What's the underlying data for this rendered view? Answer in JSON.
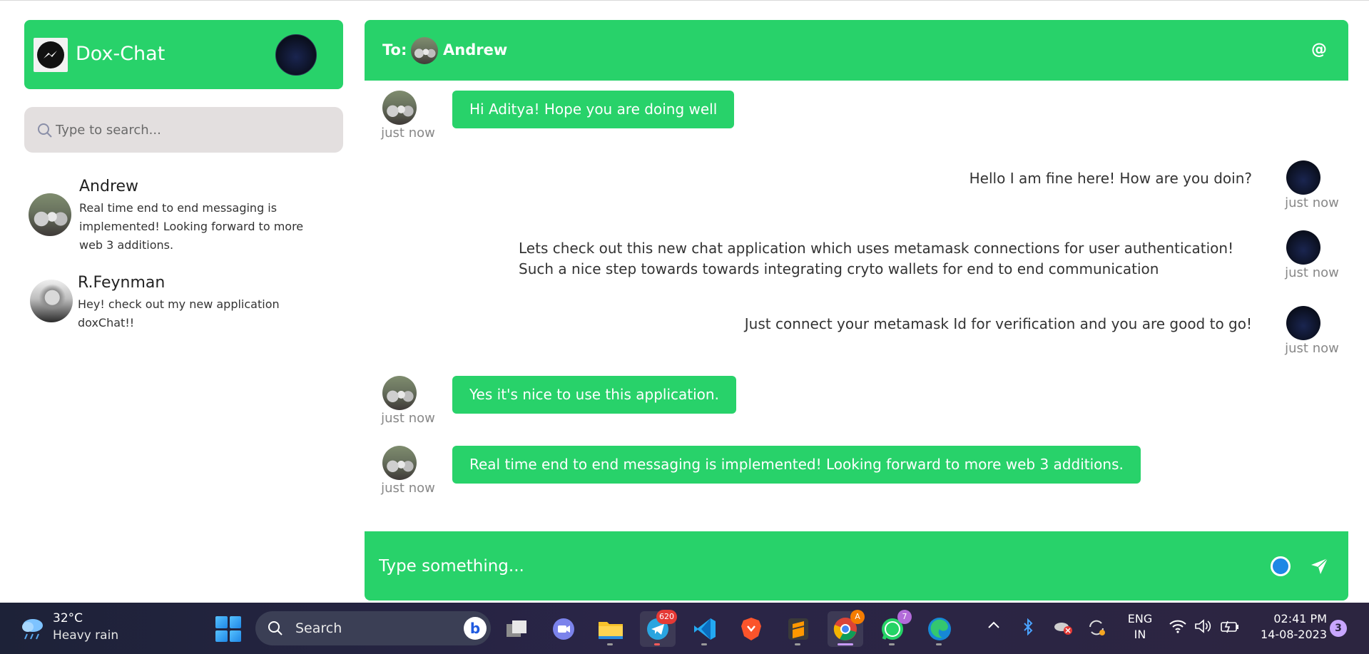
{
  "sidebar": {
    "brand_title": "Dox-Chat",
    "search_placeholder": "Type to search...",
    "contacts": [
      {
        "name": "Andrew",
        "last_message": "Real time end to end messaging is implemented! Looking forward to more web 3 additions."
      },
      {
        "name": "R.Feynman",
        "last_message": "Hey! check out my new application doxChat!!"
      }
    ]
  },
  "chat": {
    "to_label": "To:",
    "recipient": "Andrew",
    "at_symbol": "@",
    "messages": [
      {
        "direction": "incoming",
        "text": "Hi Aditya! Hope you are doing well",
        "time": "just now"
      },
      {
        "direction": "outgoing",
        "text": "Hello I am fine here! How are you doin?",
        "time": "just now"
      },
      {
        "direction": "outgoing",
        "text": "Lets check out this new chat application which uses metamask connections for user authentication! Such a nice step towards towards integrating cryto wallets for end to end communication",
        "time": "just now"
      },
      {
        "direction": "outgoing",
        "text": "Just connect your metamask Id for verification and you are good to go!",
        "time": "just now"
      },
      {
        "direction": "incoming",
        "text": "Yes it's nice to use this application.",
        "time": "just now"
      },
      {
        "direction": "incoming",
        "text": "Real time end to end messaging is implemented! Looking forward to more web 3 additions.",
        "time": "just now"
      }
    ],
    "composer_placeholder": "Type something..."
  },
  "taskbar": {
    "weather_temp": "32°C",
    "weather_condition": "Heavy rain",
    "search_label": "Search",
    "telegram_badge": "620",
    "chrome_badge": "A",
    "whatsapp_badge": "7",
    "lang_line1": "ENG",
    "lang_line2": "IN",
    "time": "02:41 PM",
    "date": "14-08-2023",
    "notification_count": "3"
  },
  "colors": {
    "accent_green": "#28d26a",
    "search_bg": "#e3dfdf",
    "taskbar_bg": "#1d2238"
  }
}
